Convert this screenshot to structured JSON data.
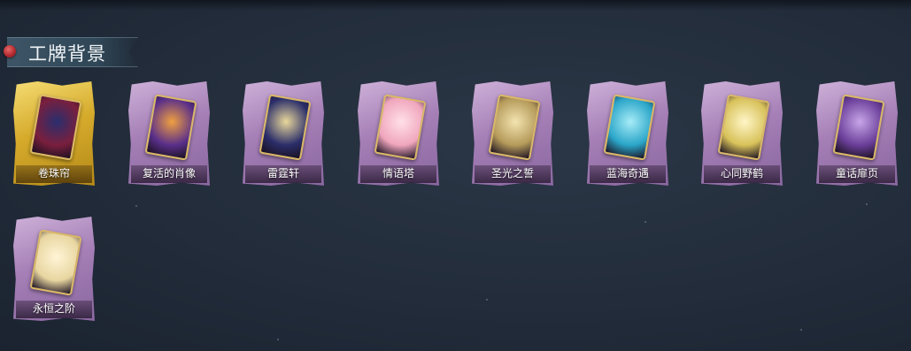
{
  "section": {
    "title": "工牌背景"
  },
  "cards": [
    {
      "name": "卷珠帘",
      "art_color": "#7a1f3d",
      "art_accent": "#2a2e6e",
      "frame": "gold"
    },
    {
      "name": "复活的肖像",
      "art_color": "#5a2f8a",
      "art_accent": "#f0a040",
      "frame": "purple"
    },
    {
      "name": "雷霆轩",
      "art_color": "#2b2e6a",
      "art_accent": "#e9d89a",
      "frame": "purple"
    },
    {
      "name": "情语塔",
      "art_color": "#f0a6bd",
      "art_accent": "#ffe0e8",
      "frame": "purple"
    },
    {
      "name": "圣光之誓",
      "art_color": "#b59a5a",
      "art_accent": "#f3e4b0",
      "frame": "purple"
    },
    {
      "name": "蓝海奇遇",
      "art_color": "#2ba6c9",
      "art_accent": "#a7ecf7",
      "frame": "purple"
    },
    {
      "name": "心同野鹤",
      "art_color": "#d8c25a",
      "art_accent": "#fff6c8",
      "frame": "purple"
    },
    {
      "name": "童话扉页",
      "art_color": "#6b3f9a",
      "art_accent": "#c7a6e8",
      "frame": "purple"
    },
    {
      "name": "永恒之阶",
      "art_color": "#e8d6a0",
      "art_accent": "#fff4d6",
      "frame": "purple"
    }
  ]
}
